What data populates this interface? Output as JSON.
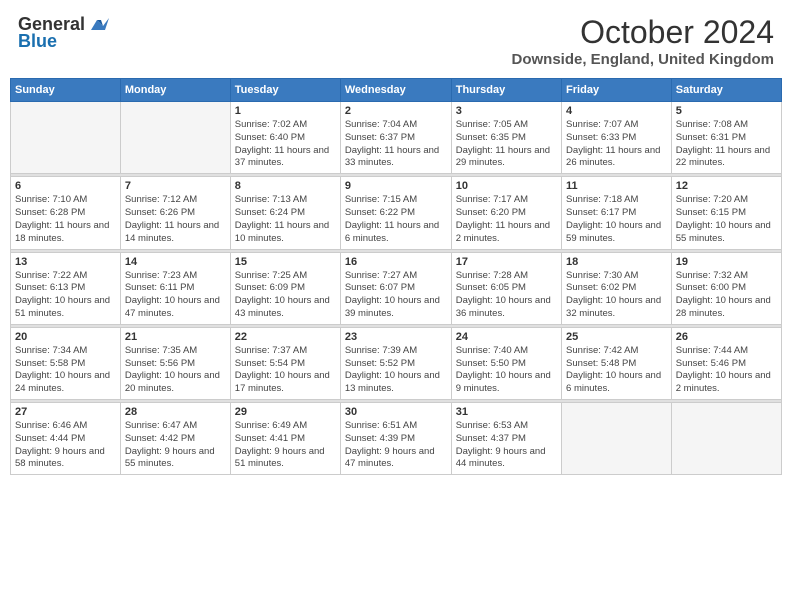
{
  "logo": {
    "general": "General",
    "blue": "Blue"
  },
  "title": "October 2024",
  "location": "Downside, England, United Kingdom",
  "days_of_week": [
    "Sunday",
    "Monday",
    "Tuesday",
    "Wednesday",
    "Thursday",
    "Friday",
    "Saturday"
  ],
  "weeks": [
    [
      {
        "day": "",
        "info": ""
      },
      {
        "day": "",
        "info": ""
      },
      {
        "day": "1",
        "info": "Sunrise: 7:02 AM\nSunset: 6:40 PM\nDaylight: 11 hours and 37 minutes."
      },
      {
        "day": "2",
        "info": "Sunrise: 7:04 AM\nSunset: 6:37 PM\nDaylight: 11 hours and 33 minutes."
      },
      {
        "day": "3",
        "info": "Sunrise: 7:05 AM\nSunset: 6:35 PM\nDaylight: 11 hours and 29 minutes."
      },
      {
        "day": "4",
        "info": "Sunrise: 7:07 AM\nSunset: 6:33 PM\nDaylight: 11 hours and 26 minutes."
      },
      {
        "day": "5",
        "info": "Sunrise: 7:08 AM\nSunset: 6:31 PM\nDaylight: 11 hours and 22 minutes."
      }
    ],
    [
      {
        "day": "6",
        "info": "Sunrise: 7:10 AM\nSunset: 6:28 PM\nDaylight: 11 hours and 18 minutes."
      },
      {
        "day": "7",
        "info": "Sunrise: 7:12 AM\nSunset: 6:26 PM\nDaylight: 11 hours and 14 minutes."
      },
      {
        "day": "8",
        "info": "Sunrise: 7:13 AM\nSunset: 6:24 PM\nDaylight: 11 hours and 10 minutes."
      },
      {
        "day": "9",
        "info": "Sunrise: 7:15 AM\nSunset: 6:22 PM\nDaylight: 11 hours and 6 minutes."
      },
      {
        "day": "10",
        "info": "Sunrise: 7:17 AM\nSunset: 6:20 PM\nDaylight: 11 hours and 2 minutes."
      },
      {
        "day": "11",
        "info": "Sunrise: 7:18 AM\nSunset: 6:17 PM\nDaylight: 10 hours and 59 minutes."
      },
      {
        "day": "12",
        "info": "Sunrise: 7:20 AM\nSunset: 6:15 PM\nDaylight: 10 hours and 55 minutes."
      }
    ],
    [
      {
        "day": "13",
        "info": "Sunrise: 7:22 AM\nSunset: 6:13 PM\nDaylight: 10 hours and 51 minutes."
      },
      {
        "day": "14",
        "info": "Sunrise: 7:23 AM\nSunset: 6:11 PM\nDaylight: 10 hours and 47 minutes."
      },
      {
        "day": "15",
        "info": "Sunrise: 7:25 AM\nSunset: 6:09 PM\nDaylight: 10 hours and 43 minutes."
      },
      {
        "day": "16",
        "info": "Sunrise: 7:27 AM\nSunset: 6:07 PM\nDaylight: 10 hours and 39 minutes."
      },
      {
        "day": "17",
        "info": "Sunrise: 7:28 AM\nSunset: 6:05 PM\nDaylight: 10 hours and 36 minutes."
      },
      {
        "day": "18",
        "info": "Sunrise: 7:30 AM\nSunset: 6:02 PM\nDaylight: 10 hours and 32 minutes."
      },
      {
        "day": "19",
        "info": "Sunrise: 7:32 AM\nSunset: 6:00 PM\nDaylight: 10 hours and 28 minutes."
      }
    ],
    [
      {
        "day": "20",
        "info": "Sunrise: 7:34 AM\nSunset: 5:58 PM\nDaylight: 10 hours and 24 minutes."
      },
      {
        "day": "21",
        "info": "Sunrise: 7:35 AM\nSunset: 5:56 PM\nDaylight: 10 hours and 20 minutes."
      },
      {
        "day": "22",
        "info": "Sunrise: 7:37 AM\nSunset: 5:54 PM\nDaylight: 10 hours and 17 minutes."
      },
      {
        "day": "23",
        "info": "Sunrise: 7:39 AM\nSunset: 5:52 PM\nDaylight: 10 hours and 13 minutes."
      },
      {
        "day": "24",
        "info": "Sunrise: 7:40 AM\nSunset: 5:50 PM\nDaylight: 10 hours and 9 minutes."
      },
      {
        "day": "25",
        "info": "Sunrise: 7:42 AM\nSunset: 5:48 PM\nDaylight: 10 hours and 6 minutes."
      },
      {
        "day": "26",
        "info": "Sunrise: 7:44 AM\nSunset: 5:46 PM\nDaylight: 10 hours and 2 minutes."
      }
    ],
    [
      {
        "day": "27",
        "info": "Sunrise: 6:46 AM\nSunset: 4:44 PM\nDaylight: 9 hours and 58 minutes."
      },
      {
        "day": "28",
        "info": "Sunrise: 6:47 AM\nSunset: 4:42 PM\nDaylight: 9 hours and 55 minutes."
      },
      {
        "day": "29",
        "info": "Sunrise: 6:49 AM\nSunset: 4:41 PM\nDaylight: 9 hours and 51 minutes."
      },
      {
        "day": "30",
        "info": "Sunrise: 6:51 AM\nSunset: 4:39 PM\nDaylight: 9 hours and 47 minutes."
      },
      {
        "day": "31",
        "info": "Sunrise: 6:53 AM\nSunset: 4:37 PM\nDaylight: 9 hours and 44 minutes."
      },
      {
        "day": "",
        "info": ""
      },
      {
        "day": "",
        "info": ""
      }
    ]
  ]
}
